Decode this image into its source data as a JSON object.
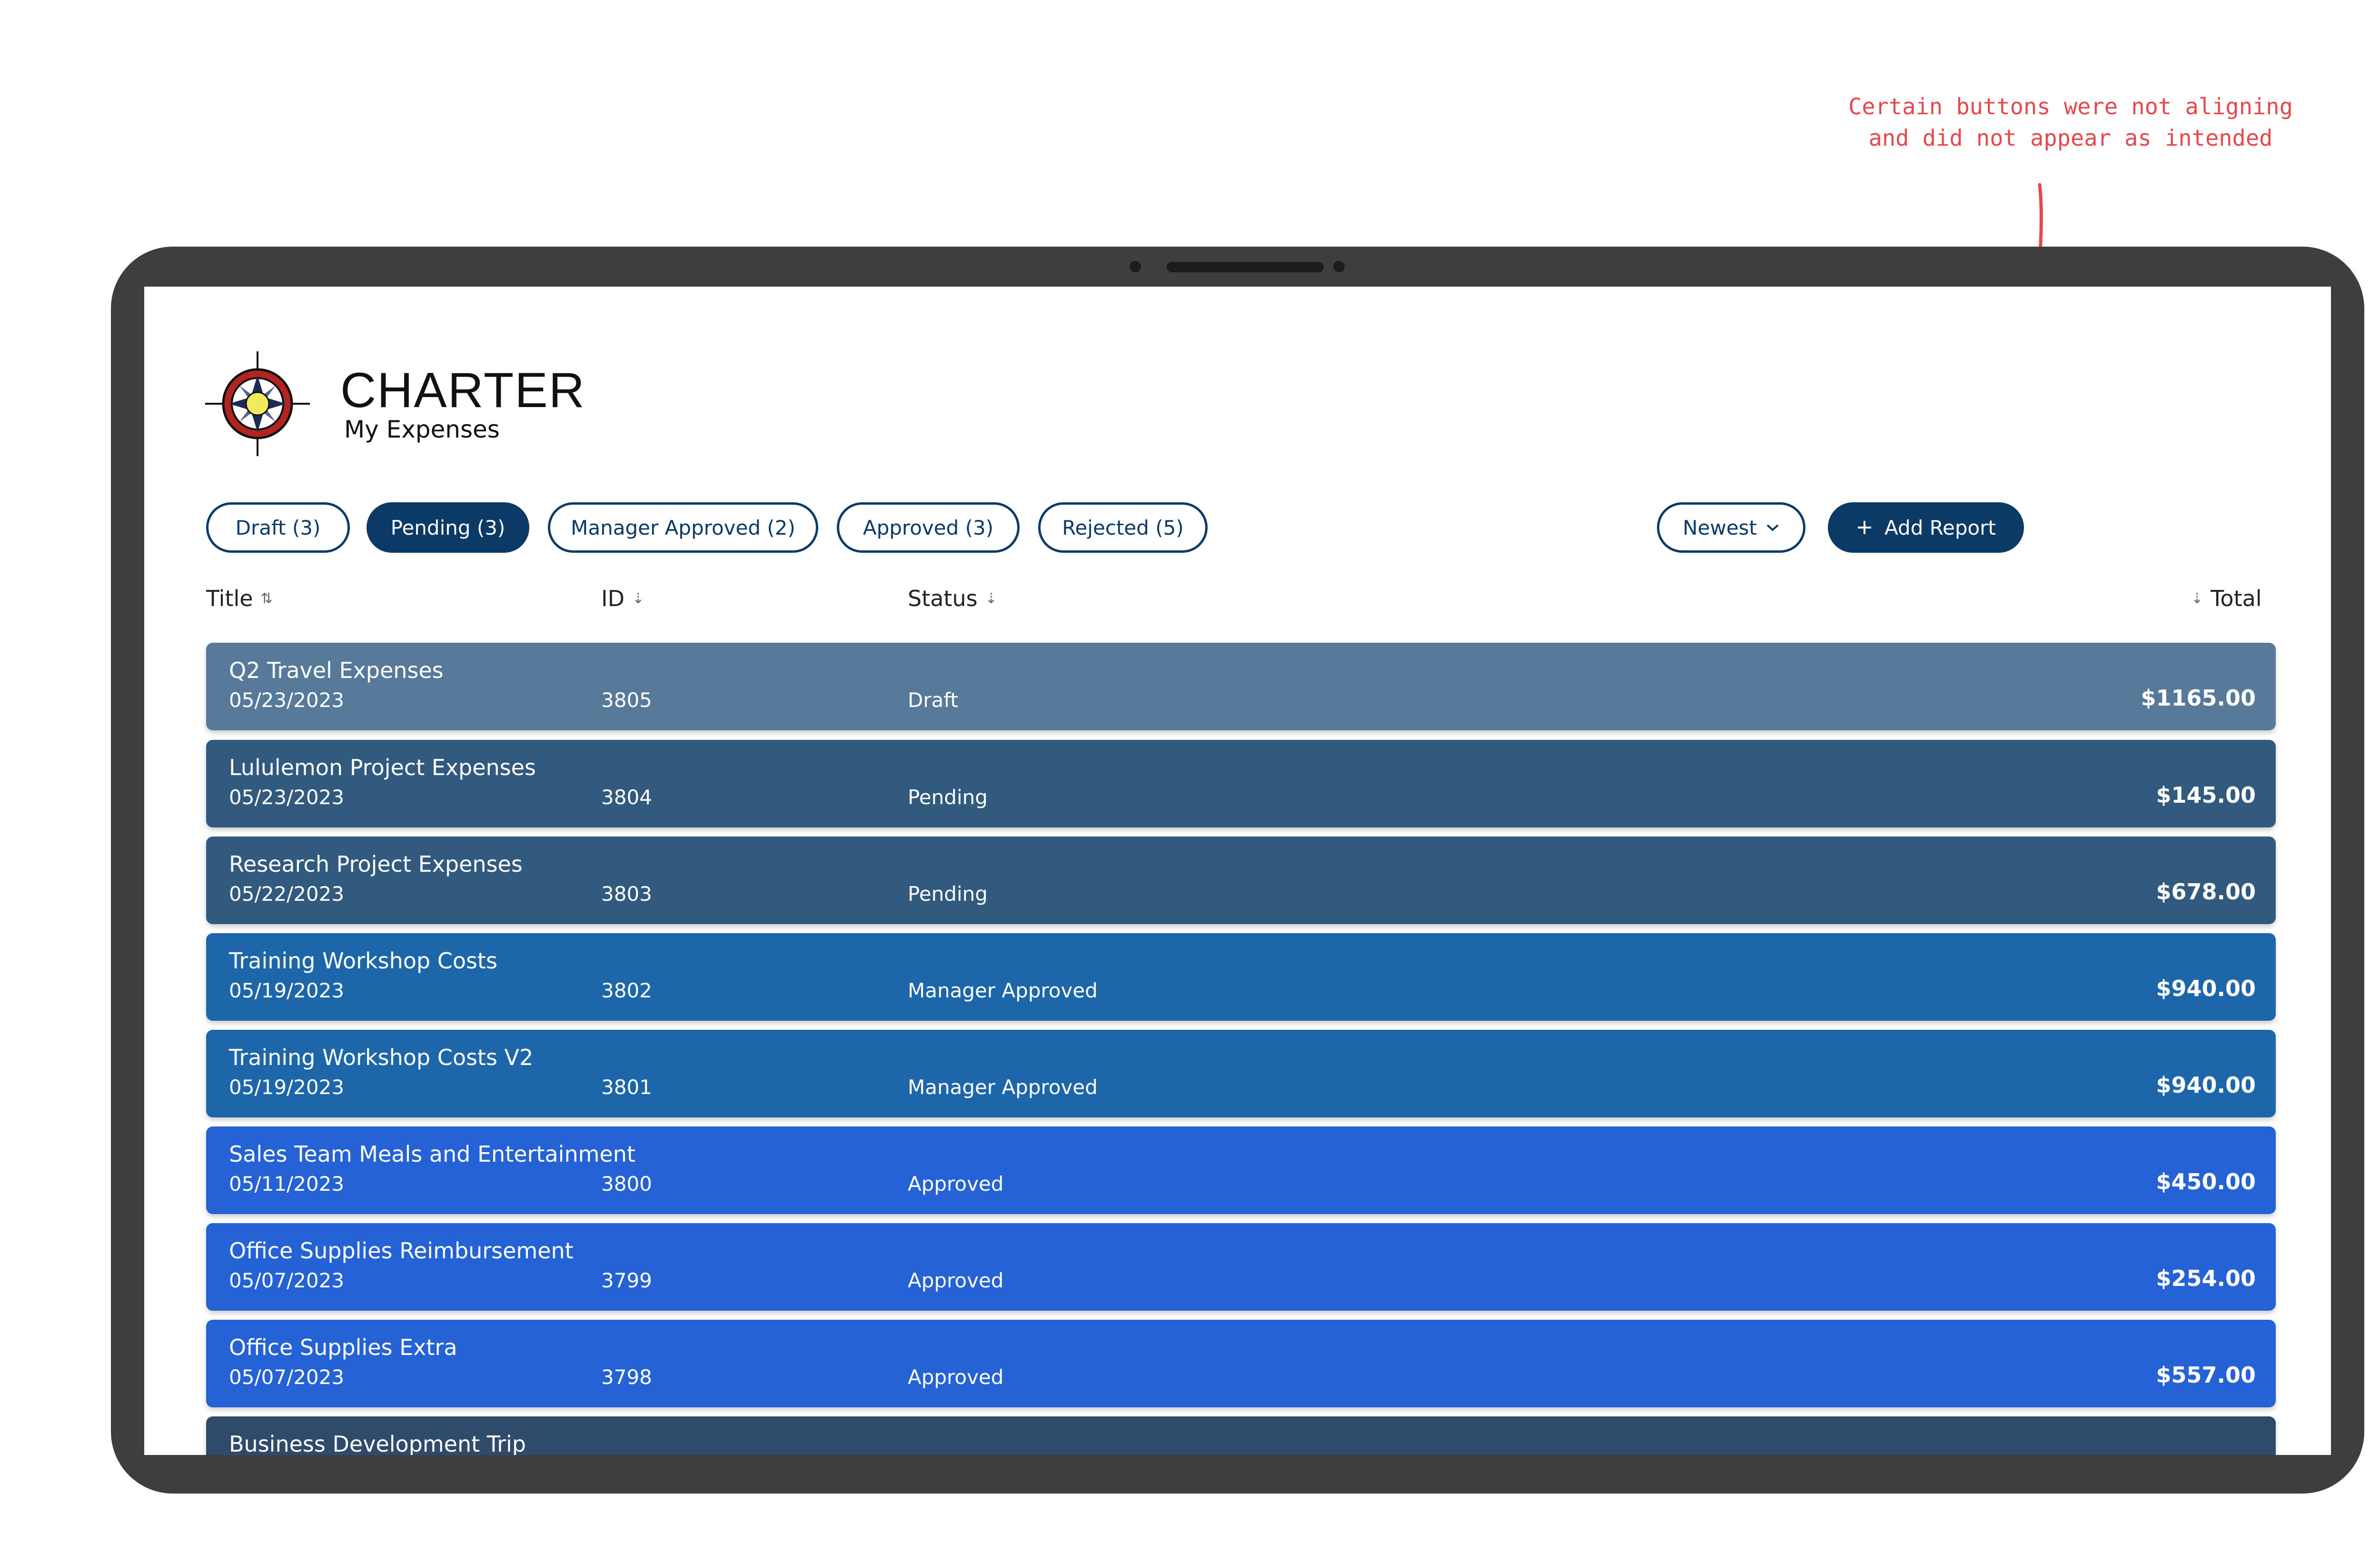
{
  "annotation": {
    "text": "Certain buttons were not aligning\nand did not appear as intended",
    "color": "#e5484d"
  },
  "app": {
    "brand": "CHARTER",
    "subtitle": "My Expenses",
    "logo_icon": "compass-rose-icon"
  },
  "filters": [
    {
      "label": "Draft (3)",
      "active": false
    },
    {
      "label": "Pending (3)",
      "active": true
    },
    {
      "label": "Manager Approved (2)",
      "active": false
    },
    {
      "label": "Approved (3)",
      "active": false
    },
    {
      "label": "Rejected (5)",
      "active": false
    }
  ],
  "sort": {
    "label": "Newest",
    "icon": "chevron-down-icon"
  },
  "add_button": {
    "label": "Add Report",
    "icon": "plus-icon"
  },
  "columns": {
    "title": "Title",
    "id": "ID",
    "status": "Status",
    "total": "Total"
  },
  "colors": {
    "primary": "#0b3a66",
    "draft": "#577a9b",
    "pending": "#325a7e",
    "manager_approved": "#1e66aa",
    "approved": "#2562d6",
    "rejected": "#2f4b6b"
  },
  "rows": [
    {
      "title": "Q2 Travel Expenses",
      "date": "05/23/2023",
      "id": "3805",
      "status": "Draft",
      "total": "$1165.00",
      "color": "#577a9b"
    },
    {
      "title": "Lululemon Project Expenses",
      "date": "05/23/2023",
      "id": "3804",
      "status": "Pending",
      "total": "$145.00",
      "color": "#325a7e"
    },
    {
      "title": "Research Project Expenses",
      "date": "05/22/2023",
      "id": "3803",
      "status": "Pending",
      "total": "$678.00",
      "color": "#325a7e"
    },
    {
      "title": "Training Workshop Costs",
      "date": "05/19/2023",
      "id": "3802",
      "status": "Manager Approved",
      "total": "$940.00",
      "color": "#1e66aa"
    },
    {
      "title": "Training Workshop Costs V2",
      "date": "05/19/2023",
      "id": "3801",
      "status": "Manager Approved",
      "total": "$940.00",
      "color": "#1e66aa"
    },
    {
      "title": "Sales Team Meals and Entertainment",
      "date": "05/11/2023",
      "id": "3800",
      "status": "Approved",
      "total": "$450.00",
      "color": "#2562d6"
    },
    {
      "title": "Office Supplies Reimbursement",
      "date": "05/07/2023",
      "id": "3799",
      "status": "Approved",
      "total": "$254.00",
      "color": "#2562d6"
    },
    {
      "title": "Office Supplies Extra",
      "date": "05/07/2023",
      "id": "3798",
      "status": "Approved",
      "total": "$557.00",
      "color": "#2562d6"
    },
    {
      "title": "Business Development Trip",
      "date": "",
      "id": "",
      "status": "",
      "total": "",
      "color": "#2f4b6b"
    }
  ]
}
